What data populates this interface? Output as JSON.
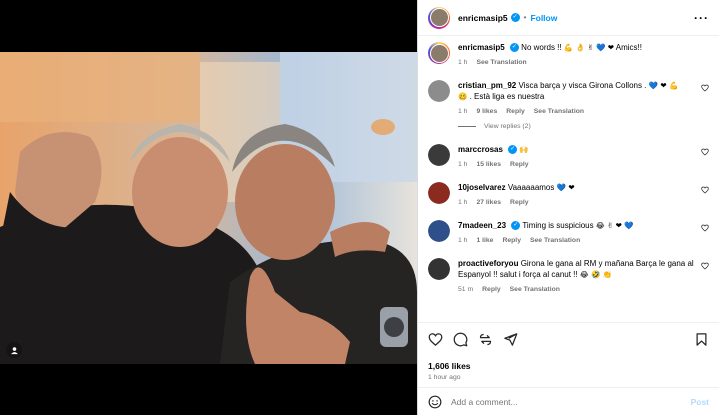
{
  "post": {
    "author": "enricmasip5",
    "follow_label": "Follow",
    "caption_text": "No words !!",
    "caption_emojis": "💪 👌 ✌ 💙 ❤",
    "caption_suffix": "Amics!!",
    "caption_time": "1 h",
    "see_translation": "See Translation"
  },
  "comments": [
    {
      "user": "cristian_pm_92",
      "verified": false,
      "text": "Visca barça y visca Girona Collons .",
      "emojis": "💙 ❤ 💪",
      "text2_emoji": "🥴",
      "text2": ". Està liga es nuestra",
      "time": "1 h",
      "likes": "9 likes",
      "reply": "Reply",
      "translate": "See Translation",
      "view_replies": "View replies (2)"
    },
    {
      "user": "marccrosas",
      "verified": true,
      "text": "",
      "emojis": "🙌",
      "time": "1 h",
      "likes": "15 likes",
      "reply": "Reply"
    },
    {
      "user": "10joselvarez",
      "verified": false,
      "text": "Vaaaaaamos",
      "emojis": "💙 ❤",
      "time": "1 h",
      "likes": "27 likes",
      "reply": "Reply"
    },
    {
      "user": "7madeen_23",
      "verified": true,
      "text": "Timing is suspicious",
      "emojis": "😂 ✌ ❤ 💙",
      "time": "1 h",
      "likes": "1 like",
      "reply": "Reply",
      "translate": "See Translation"
    },
    {
      "user": "proactiveforyou",
      "verified": false,
      "text": "Girona le gana al RM y mañana Barça le gana al Espanyol !! salut i força al canut !!",
      "emojis": "😂 🤣 👏",
      "time": "51 m",
      "reply": "Reply",
      "translate": "See Translation"
    }
  ],
  "stats": {
    "likes": "1,606 likes",
    "posted": "1 hour ago"
  },
  "composer": {
    "placeholder": "Add a comment...",
    "post_label": "Post"
  },
  "icons": {
    "like": "heart-icon",
    "comment": "comment-icon",
    "share": "share-icon",
    "save": "bookmark-icon",
    "emoji": "smiley-icon",
    "more": "more-icon",
    "tag": "user-tag-icon"
  },
  "colors": {
    "accent": "#0095f6",
    "muted": "#737373"
  }
}
